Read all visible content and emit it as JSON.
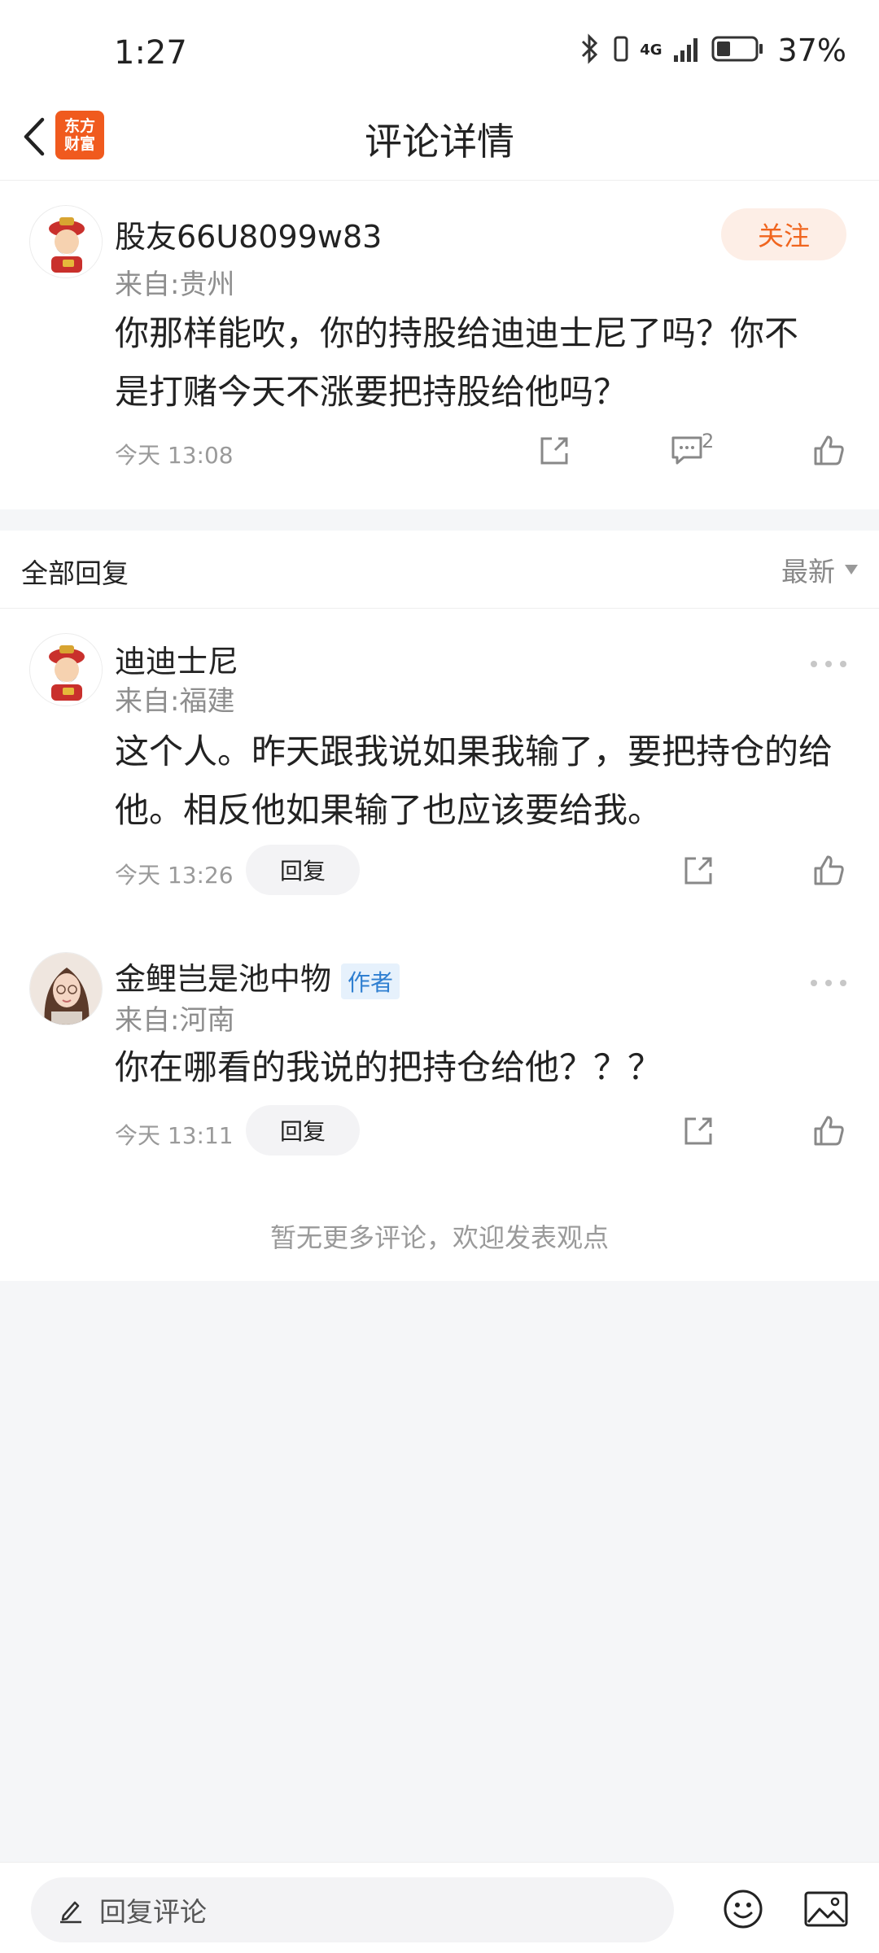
{
  "status_bar": {
    "time": "1:27",
    "network": "4G",
    "battery": "37%",
    "battery_level": 0.37
  },
  "nav": {
    "title": "评论详情",
    "logo_line1": "东方",
    "logo_line2": "财富"
  },
  "main_comment": {
    "username": "股友66U8099w83",
    "location": "来自:贵州",
    "follow_label": "关注",
    "text": "你那样能吹，你的持股给迪迪士尼了吗？你不是打赌今天不涨要把持股给他吗？",
    "time": "今天 13:08",
    "comment_count": "2"
  },
  "replies_section": {
    "title": "全部回复",
    "sort_label": "最新"
  },
  "replies": [
    {
      "username": "迪迪士尼",
      "location": "来自:福建",
      "text": "这个人。昨天跟我说如果我输了，要把持仓的给他。相反他如果输了也应该要给我。",
      "time": "今天 13:26",
      "reply_label": "回复"
    },
    {
      "username": "金鲤岂是池中物",
      "badge": "作者",
      "location": "来自:河南",
      "text": "你在哪看的我说的把持仓给他？？？",
      "time": "今天 13:11",
      "reply_label": "回复"
    }
  ],
  "end_text": "暂无更多评论，欢迎发表观点",
  "bottom_bar": {
    "placeholder": "回复评论"
  },
  "colors": {
    "accent": "#f0651e",
    "author_badge": "#2f7fd1",
    "page_bg": "#f5f6f8"
  }
}
